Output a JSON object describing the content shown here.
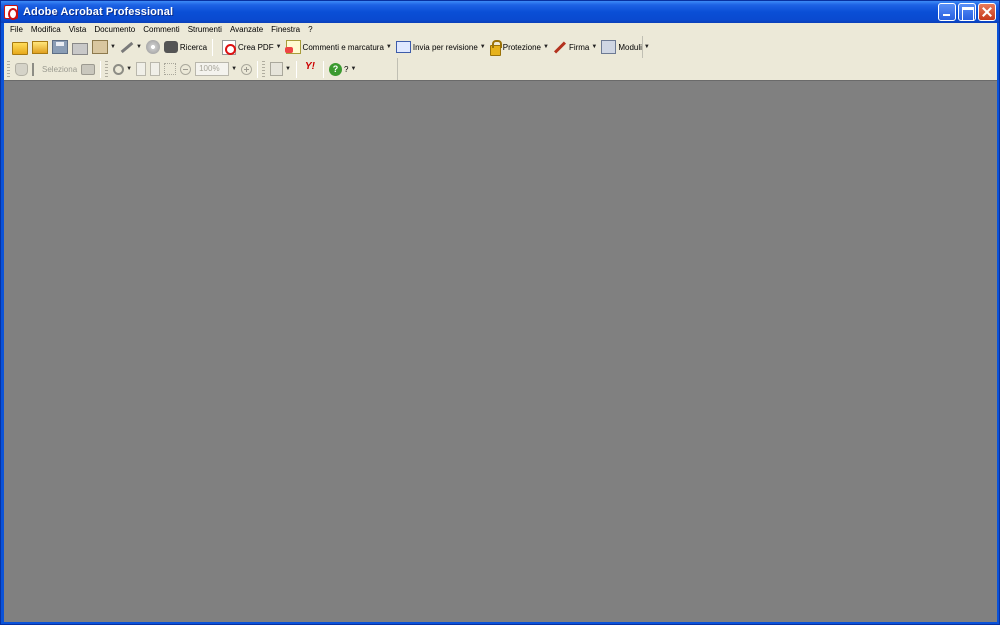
{
  "window": {
    "title": "Adobe Acrobat Professional"
  },
  "menubar": {
    "items": [
      "File",
      "Modifica",
      "Vista",
      "Documento",
      "Commenti",
      "Strumenti",
      "Avanzate",
      "Finestra",
      "?"
    ]
  },
  "toolbar1": {
    "search_label": "Ricerca",
    "create_pdf_label": "Crea PDF",
    "comments_label": "Commenti e marcatura",
    "send_review_label": "Invia per revisione",
    "protection_label": "Protezione",
    "sign_label": "Firma",
    "forms_label": "Moduli"
  },
  "toolbar2": {
    "select_label": "Seleziona",
    "zoom_value": "100%",
    "help_label": "?"
  },
  "icons": {
    "app": "acrobat-icon",
    "open": "folder-open-icon",
    "organizer": "folder-icon",
    "save": "disk-icon",
    "print": "printer-icon",
    "attach": "clipboard-icon",
    "pen": "pen-icon",
    "cd": "cd-icon",
    "search": "binoculars-icon",
    "yahoo": "Y!"
  }
}
